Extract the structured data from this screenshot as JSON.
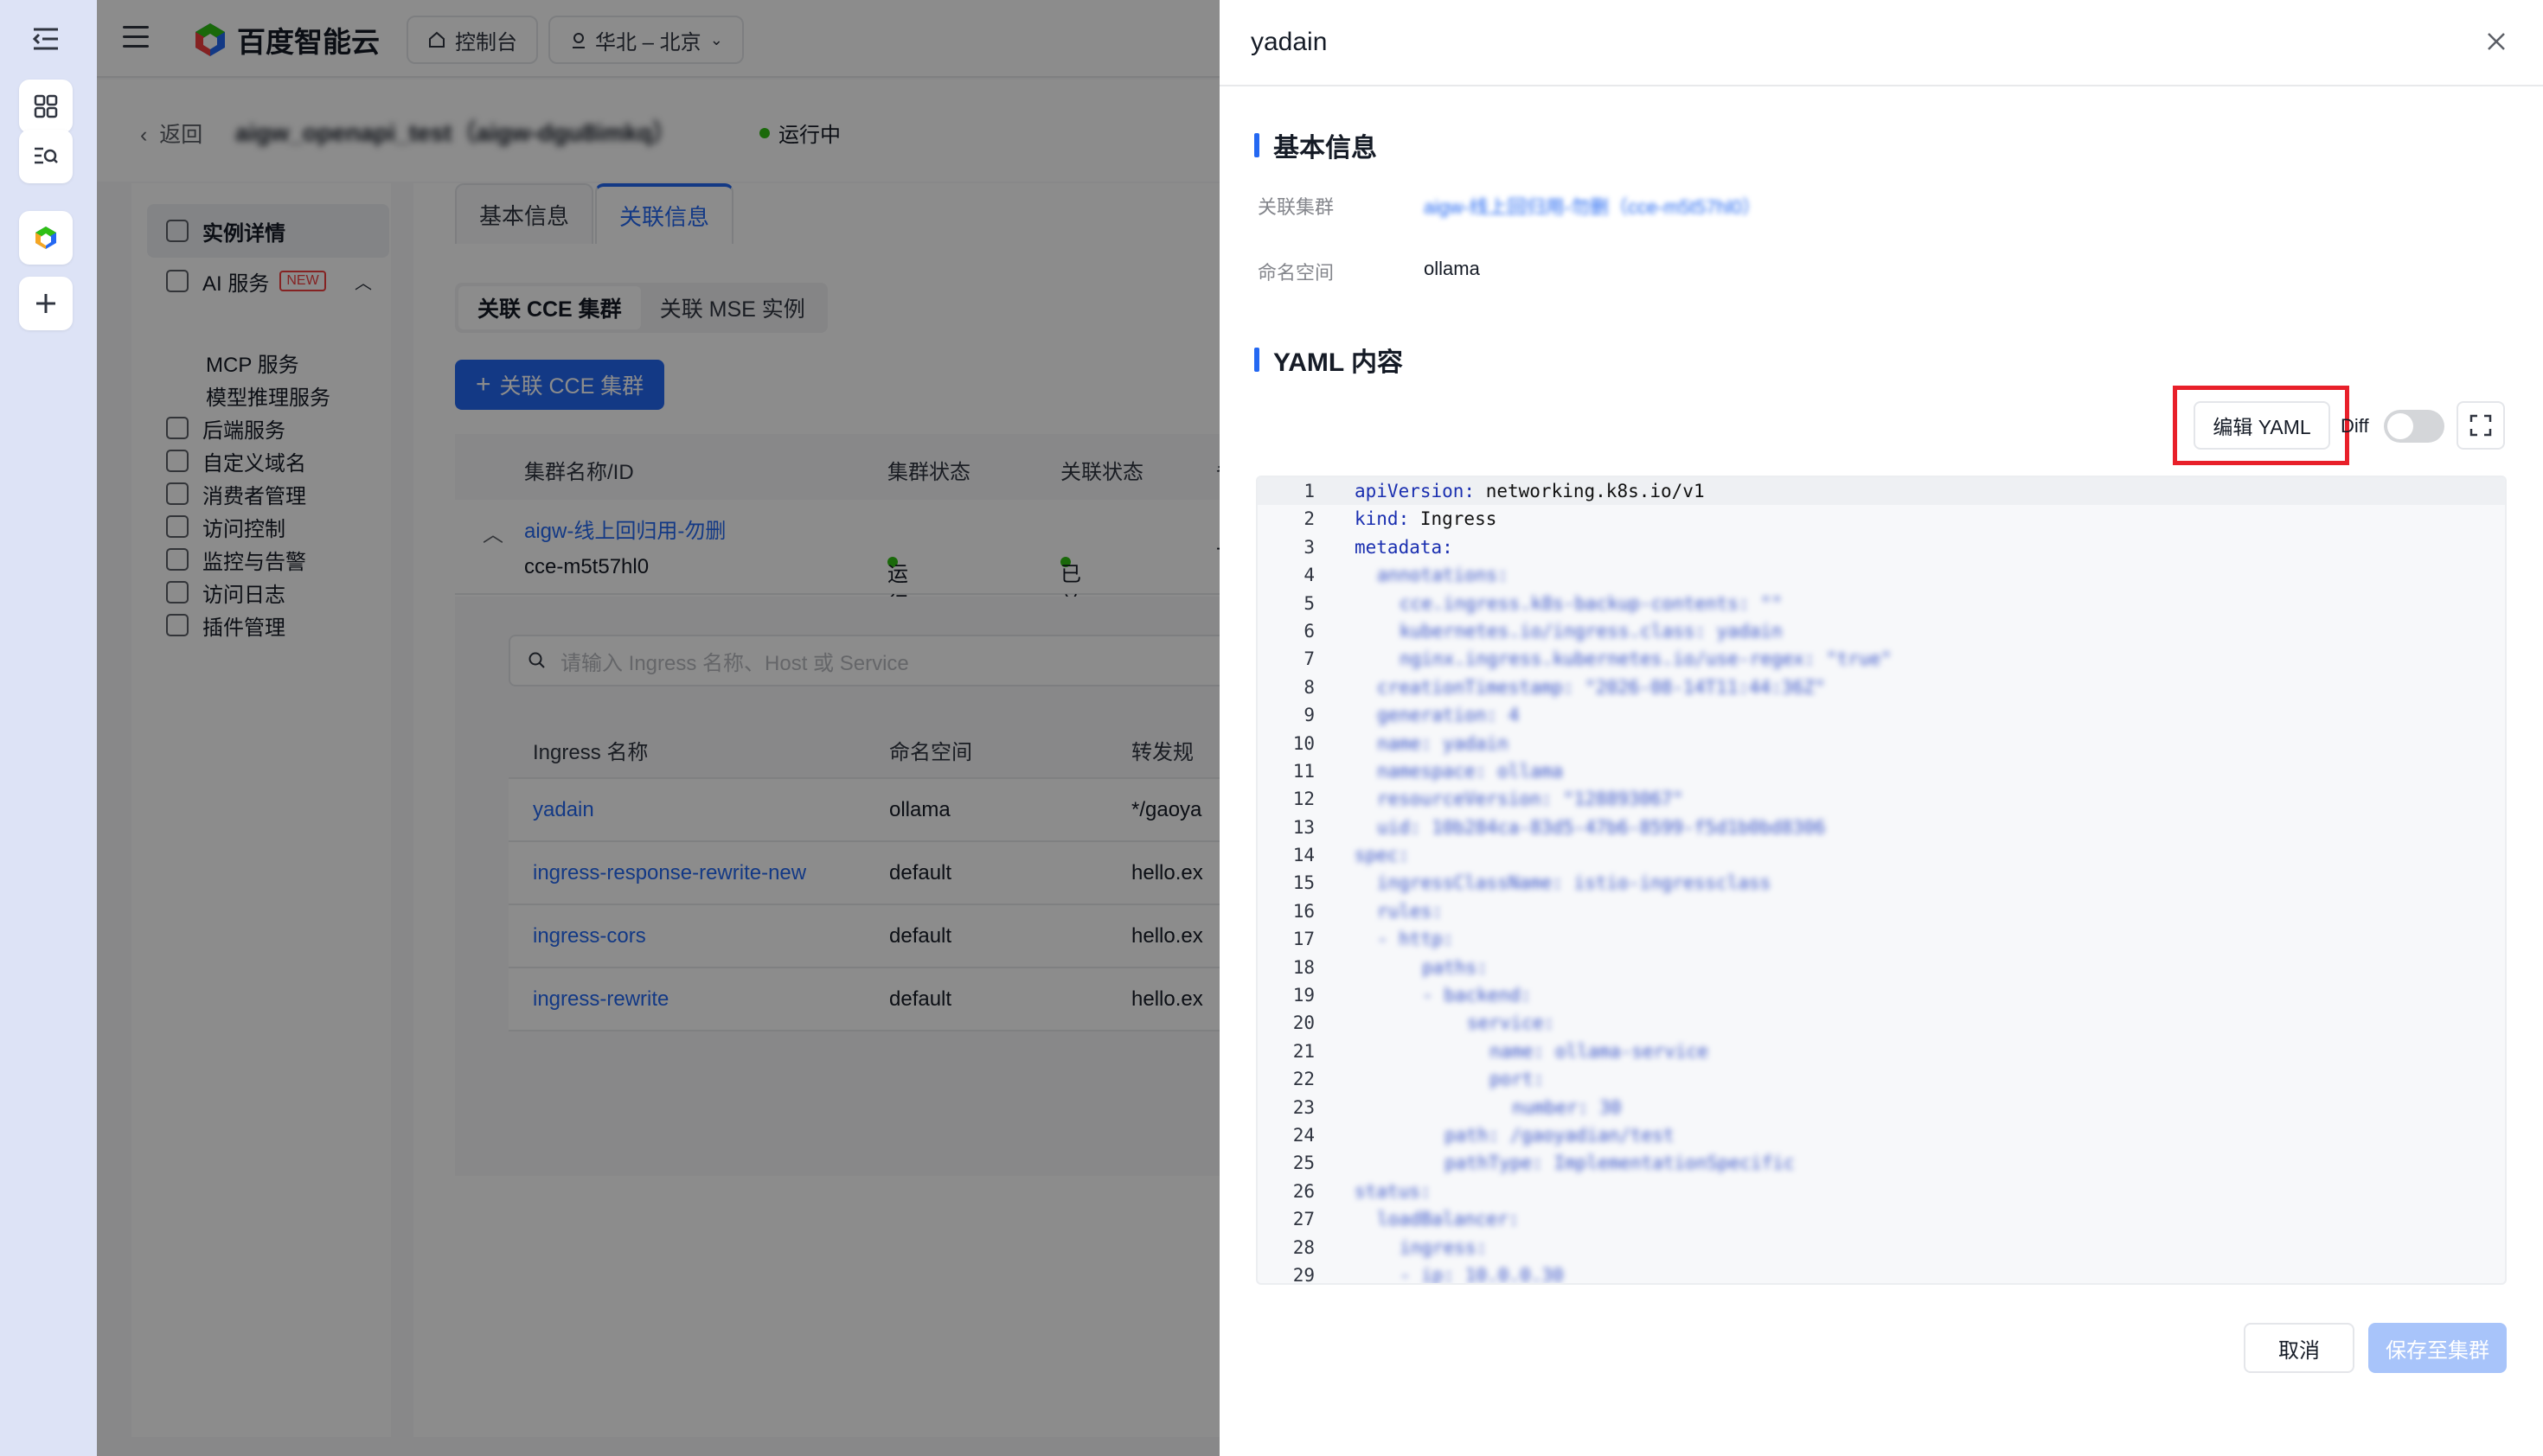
{
  "topbar": {
    "brand": "百度智能云",
    "console_label": "控制台",
    "region_label": "华北 – 北京"
  },
  "crumb": {
    "back_label": "返回",
    "instance_title": "aigw_openapi_test（aigw-dgu8imkq）",
    "status": "运行中"
  },
  "sidenav": {
    "items": [
      {
        "label": "实例详情"
      },
      {
        "label": "AI 服务",
        "badge": "NEW"
      },
      {
        "label": "MCP 服务"
      },
      {
        "label": "模型推理服务"
      },
      {
        "label": "后端服务"
      },
      {
        "label": "自定义域名"
      },
      {
        "label": "消费者管理"
      },
      {
        "label": "访问控制"
      },
      {
        "label": "监控与告警"
      },
      {
        "label": "访问日志"
      },
      {
        "label": "插件管理"
      }
    ]
  },
  "main": {
    "tabs": [
      "基本信息",
      "关联信息"
    ],
    "segments": [
      "关联 CCE 集群",
      "关联 MSE 实例"
    ],
    "add_button": "关联 CCE 集群",
    "columns": [
      "集群名称/ID",
      "集群状态",
      "关联状态",
      "备"
    ],
    "cluster": {
      "name": "aigw-线上回归用-勿删",
      "id": "cce-m5t57hl0",
      "state": "运行中",
      "assoc": "已关联",
      "note": "-"
    },
    "search_placeholder": "请输入 Ingress 名称、Host 或 Service",
    "ingress_columns": [
      "Ingress 名称",
      "命名空间",
      "转发规"
    ],
    "ingress_rows": [
      {
        "name": "yadain",
        "ns": "ollama",
        "rule": "*/gaoya"
      },
      {
        "name": "ingress-response-rewrite-new",
        "ns": "default",
        "rule": "hello.ex"
      },
      {
        "name": "ingress-cors",
        "ns": "default",
        "rule": "hello.ex"
      },
      {
        "name": "ingress-rewrite",
        "ns": "default",
        "rule": "hello.ex"
      }
    ]
  },
  "drawer": {
    "title": "yadain",
    "basic_section": "基本信息",
    "cluster_label": "关联集群",
    "cluster_value": "aigw-线上回归用-勿删（cce-m5t57hl0）",
    "namespace_label": "命名空间",
    "namespace_value": "ollama",
    "yaml_section": "YAML 内容",
    "edit_yaml": "编辑 YAML",
    "diff_label": "Diff",
    "cancel": "取消",
    "save": "保存至集群",
    "yaml_lines": [
      {
        "n": "1",
        "k": "apiVersion",
        "v": "networking.k8s.io/v1",
        "blur": false,
        "indent": 0
      },
      {
        "n": "2",
        "k": "kind",
        "v": "Ingress",
        "blur": false,
        "indent": 0
      },
      {
        "n": "3",
        "k": "metadata",
        "v": "",
        "blur": false,
        "indent": 0
      },
      {
        "n": "4",
        "k": "annotations",
        "v": "",
        "blur": true,
        "indent": 1
      },
      {
        "n": "5",
        "k": "cce.ingress.k8s-backup-contents",
        "v": "\"\"",
        "blur": true,
        "indent": 2
      },
      {
        "n": "6",
        "k": "kubernetes.io/ingress.class",
        "v": "yadain",
        "blur": true,
        "indent": 2
      },
      {
        "n": "7",
        "k": "nginx.ingress.kubernetes.io/use-regex",
        "v": "\"true\"",
        "blur": true,
        "indent": 2
      },
      {
        "n": "8",
        "k": "creationTimestamp",
        "v": "\"2026-08-14T11:44:36Z\"",
        "blur": true,
        "indent": 1
      },
      {
        "n": "9",
        "k": "generation",
        "v": "4",
        "blur": true,
        "indent": 1
      },
      {
        "n": "10",
        "k": "name",
        "v": "yadain",
        "blur": true,
        "indent": 1
      },
      {
        "n": "11",
        "k": "namespace",
        "v": "ollama",
        "blur": true,
        "indent": 1
      },
      {
        "n": "12",
        "k": "resourceVersion",
        "v": "\"128893067\"",
        "blur": true,
        "indent": 1
      },
      {
        "n": "13",
        "k": "uid",
        "v": "10b284ca-83d5-47b6-8599-f5d1b0bd8306",
        "blur": true,
        "indent": 1
      },
      {
        "n": "14",
        "k": "spec",
        "v": "",
        "blur": true,
        "indent": 0
      },
      {
        "n": "15",
        "k": "ingressClassName",
        "v": "istio-ingressclass",
        "blur": true,
        "indent": 1
      },
      {
        "n": "16",
        "k": "rules",
        "v": "",
        "blur": true,
        "indent": 1
      },
      {
        "n": "17",
        "k": "- http",
        "v": "",
        "blur": true,
        "indent": 1
      },
      {
        "n": "18",
        "k": "paths",
        "v": "",
        "blur": true,
        "indent": 3
      },
      {
        "n": "19",
        "k": "- backend",
        "v": "",
        "blur": true,
        "indent": 3
      },
      {
        "n": "20",
        "k": "service",
        "v": "",
        "blur": true,
        "indent": 5
      },
      {
        "n": "21",
        "k": "name",
        "v": "ollama-service",
        "blur": true,
        "indent": 6
      },
      {
        "n": "22",
        "k": "port",
        "v": "",
        "blur": true,
        "indent": 6
      },
      {
        "n": "23",
        "k": "number",
        "v": "30",
        "blur": true,
        "indent": 7
      },
      {
        "n": "24",
        "k": "path",
        "v": "/gaoyadian/test",
        "blur": true,
        "indent": 4
      },
      {
        "n": "25",
        "k": "pathType",
        "v": "ImplementationSpecific",
        "blur": true,
        "indent": 4
      },
      {
        "n": "26",
        "k": "status",
        "v": "",
        "blur": true,
        "indent": 0
      },
      {
        "n": "27",
        "k": "loadBalancer",
        "v": "",
        "blur": true,
        "indent": 1
      },
      {
        "n": "28",
        "k": "ingress",
        "v": "",
        "blur": true,
        "indent": 2
      },
      {
        "n": "29",
        "k": "- ip",
        "v": "10.0.0.30",
        "blur": true,
        "indent": 2
      }
    ]
  },
  "colors": {
    "accent": "#2468f2",
    "highlight": "#e8202a",
    "status_ok": "#30bf13"
  }
}
